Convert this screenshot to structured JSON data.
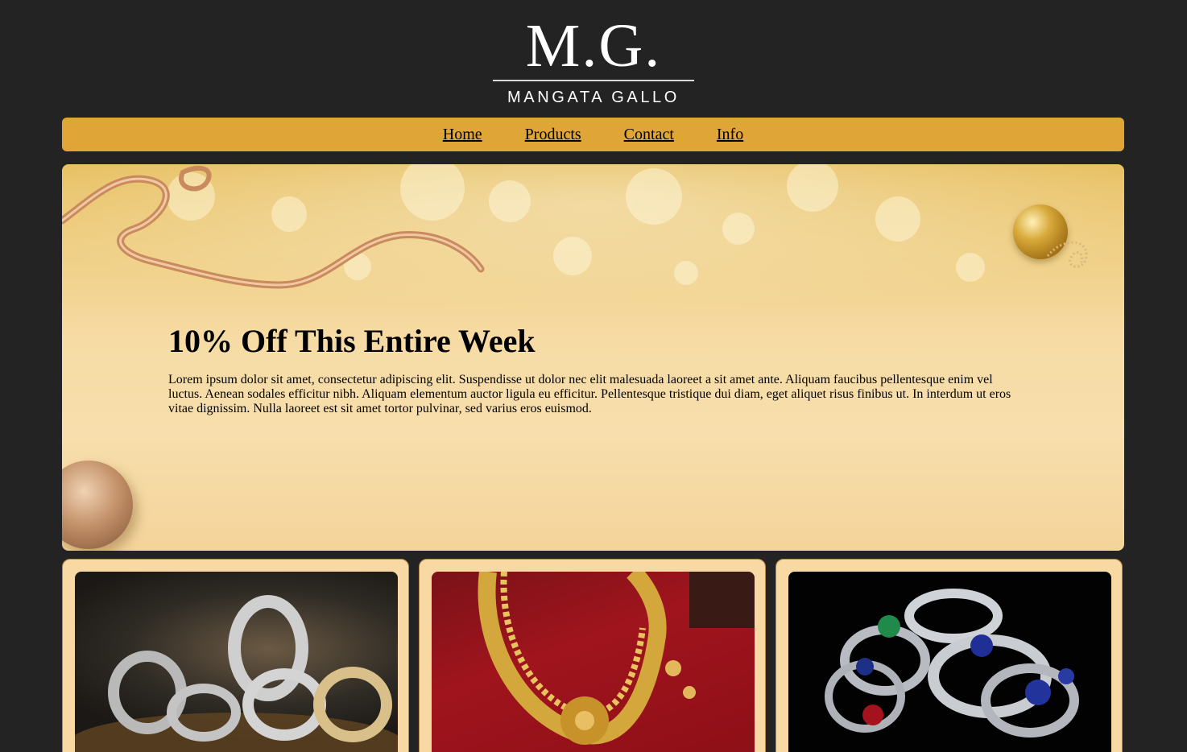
{
  "logo": {
    "mark": "M.G.",
    "subtitle": "MANGATA GALLO"
  },
  "nav": {
    "items": [
      {
        "label": "Home"
      },
      {
        "label": "Products"
      },
      {
        "label": "Contact"
      },
      {
        "label": "Info"
      }
    ]
  },
  "hero": {
    "title": "10% Off This Entire Week",
    "text": "Lorem ipsum dolor sit amet, consectetur adipiscing elit. Suspendisse ut dolor nec elit malesuada laoreet a sit amet ante. Aliquam faucibus pellentesque enim vel luctus. Aenean sodales efficitur nibh. Aliquam elementum auctor ligula eu efficitur. Pellentesque tristique dui diam, eget aliquet risus finibus ut. In interdum ut eros vitae dignissim. Nulla laoreet est sit amet tortor pulvinar, sed varius eros euismod."
  },
  "colors": {
    "page_background": "#232323",
    "nav_background": "#dfa637",
    "card_background": "#f8d8a3"
  }
}
